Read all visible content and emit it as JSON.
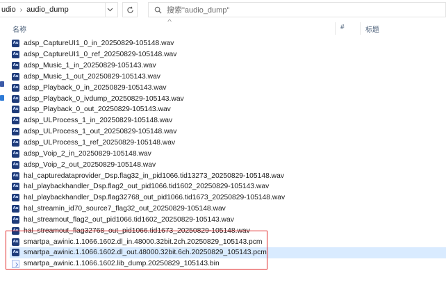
{
  "breadcrumb": {
    "parent": "udio",
    "current": "audio_dump"
  },
  "toolbar": {
    "dropdown_icon": "chevron-down-icon",
    "refresh_icon": "refresh-icon"
  },
  "search": {
    "placeholder": "搜索\"audio_dump\""
  },
  "columns": {
    "name": "名称",
    "number": "#",
    "title": "标题"
  },
  "files": [
    {
      "name": "adsp_CaptureUI1_0_in_20250829-105148.wav",
      "type": "audio"
    },
    {
      "name": "adsp_CaptureUI1_0_ref_20250829-105148.wav",
      "type": "audio"
    },
    {
      "name": "adsp_Music_1_in_20250829-105143.wav",
      "type": "audio"
    },
    {
      "name": "adsp_Music_1_out_20250829-105143.wav",
      "type": "audio"
    },
    {
      "name": "adsp_Playback_0_in_20250829-105143.wav",
      "type": "audio"
    },
    {
      "name": "adsp_Playback_0_ivdump_20250829-105143.wav",
      "type": "audio"
    },
    {
      "name": "adsp_Playback_0_out_20250829-105143.wav",
      "type": "audio"
    },
    {
      "name": "adsp_ULProcess_1_in_20250829-105148.wav",
      "type": "audio"
    },
    {
      "name": "adsp_ULProcess_1_out_20250829-105148.wav",
      "type": "audio"
    },
    {
      "name": "adsp_ULProcess_1_ref_20250829-105148.wav",
      "type": "audio"
    },
    {
      "name": "adsp_Voip_2_in_20250829-105148.wav",
      "type": "audio"
    },
    {
      "name": "adsp_Voip_2_out_20250829-105148.wav",
      "type": "audio"
    },
    {
      "name": "hal_capturedataprovider_Dsp.flag32_in_pid1066.tid13273_20250829-105148.wav",
      "type": "audio"
    },
    {
      "name": "hal_playbackhandler_Dsp.flag2_out_pid1066.tid1602_20250829-105143.wav",
      "type": "audio"
    },
    {
      "name": "hal_playbackhandler_Dsp.flag32768_out_pid1066.tid1673_20250829-105148.wav",
      "type": "audio"
    },
    {
      "name": "hal_streamin_id70_source7_flag32_out_20250829-105148.wav",
      "type": "audio"
    },
    {
      "name": "hal_streamout_flag2_out_pid1066.tid1602_20250829-105143.wav",
      "type": "audio"
    },
    {
      "name": "hal_streamout_flag32768_out_pid1066.tid1673_20250829-105148.wav",
      "type": "audio"
    },
    {
      "name": "smartpa_awinic.1.1066.1602.dl_in.48000.32bit.2ch.20250829_105143.pcm",
      "type": "audio"
    },
    {
      "name": "smartpa_awinic.1.1066.1602.dl_out.48000.32bit.6ch.20250829_105143.pcm",
      "type": "audio",
      "selected": true
    },
    {
      "name": "smartpa_awinic.1.1066.1602.lib_dump.20250829_105143.bin",
      "type": "binary"
    }
  ],
  "file_icon_label": "Au",
  "colors": {
    "selection": "#d9ebff",
    "highlight_box": "#e02525",
    "audio_icon": "#1f3c7a"
  }
}
